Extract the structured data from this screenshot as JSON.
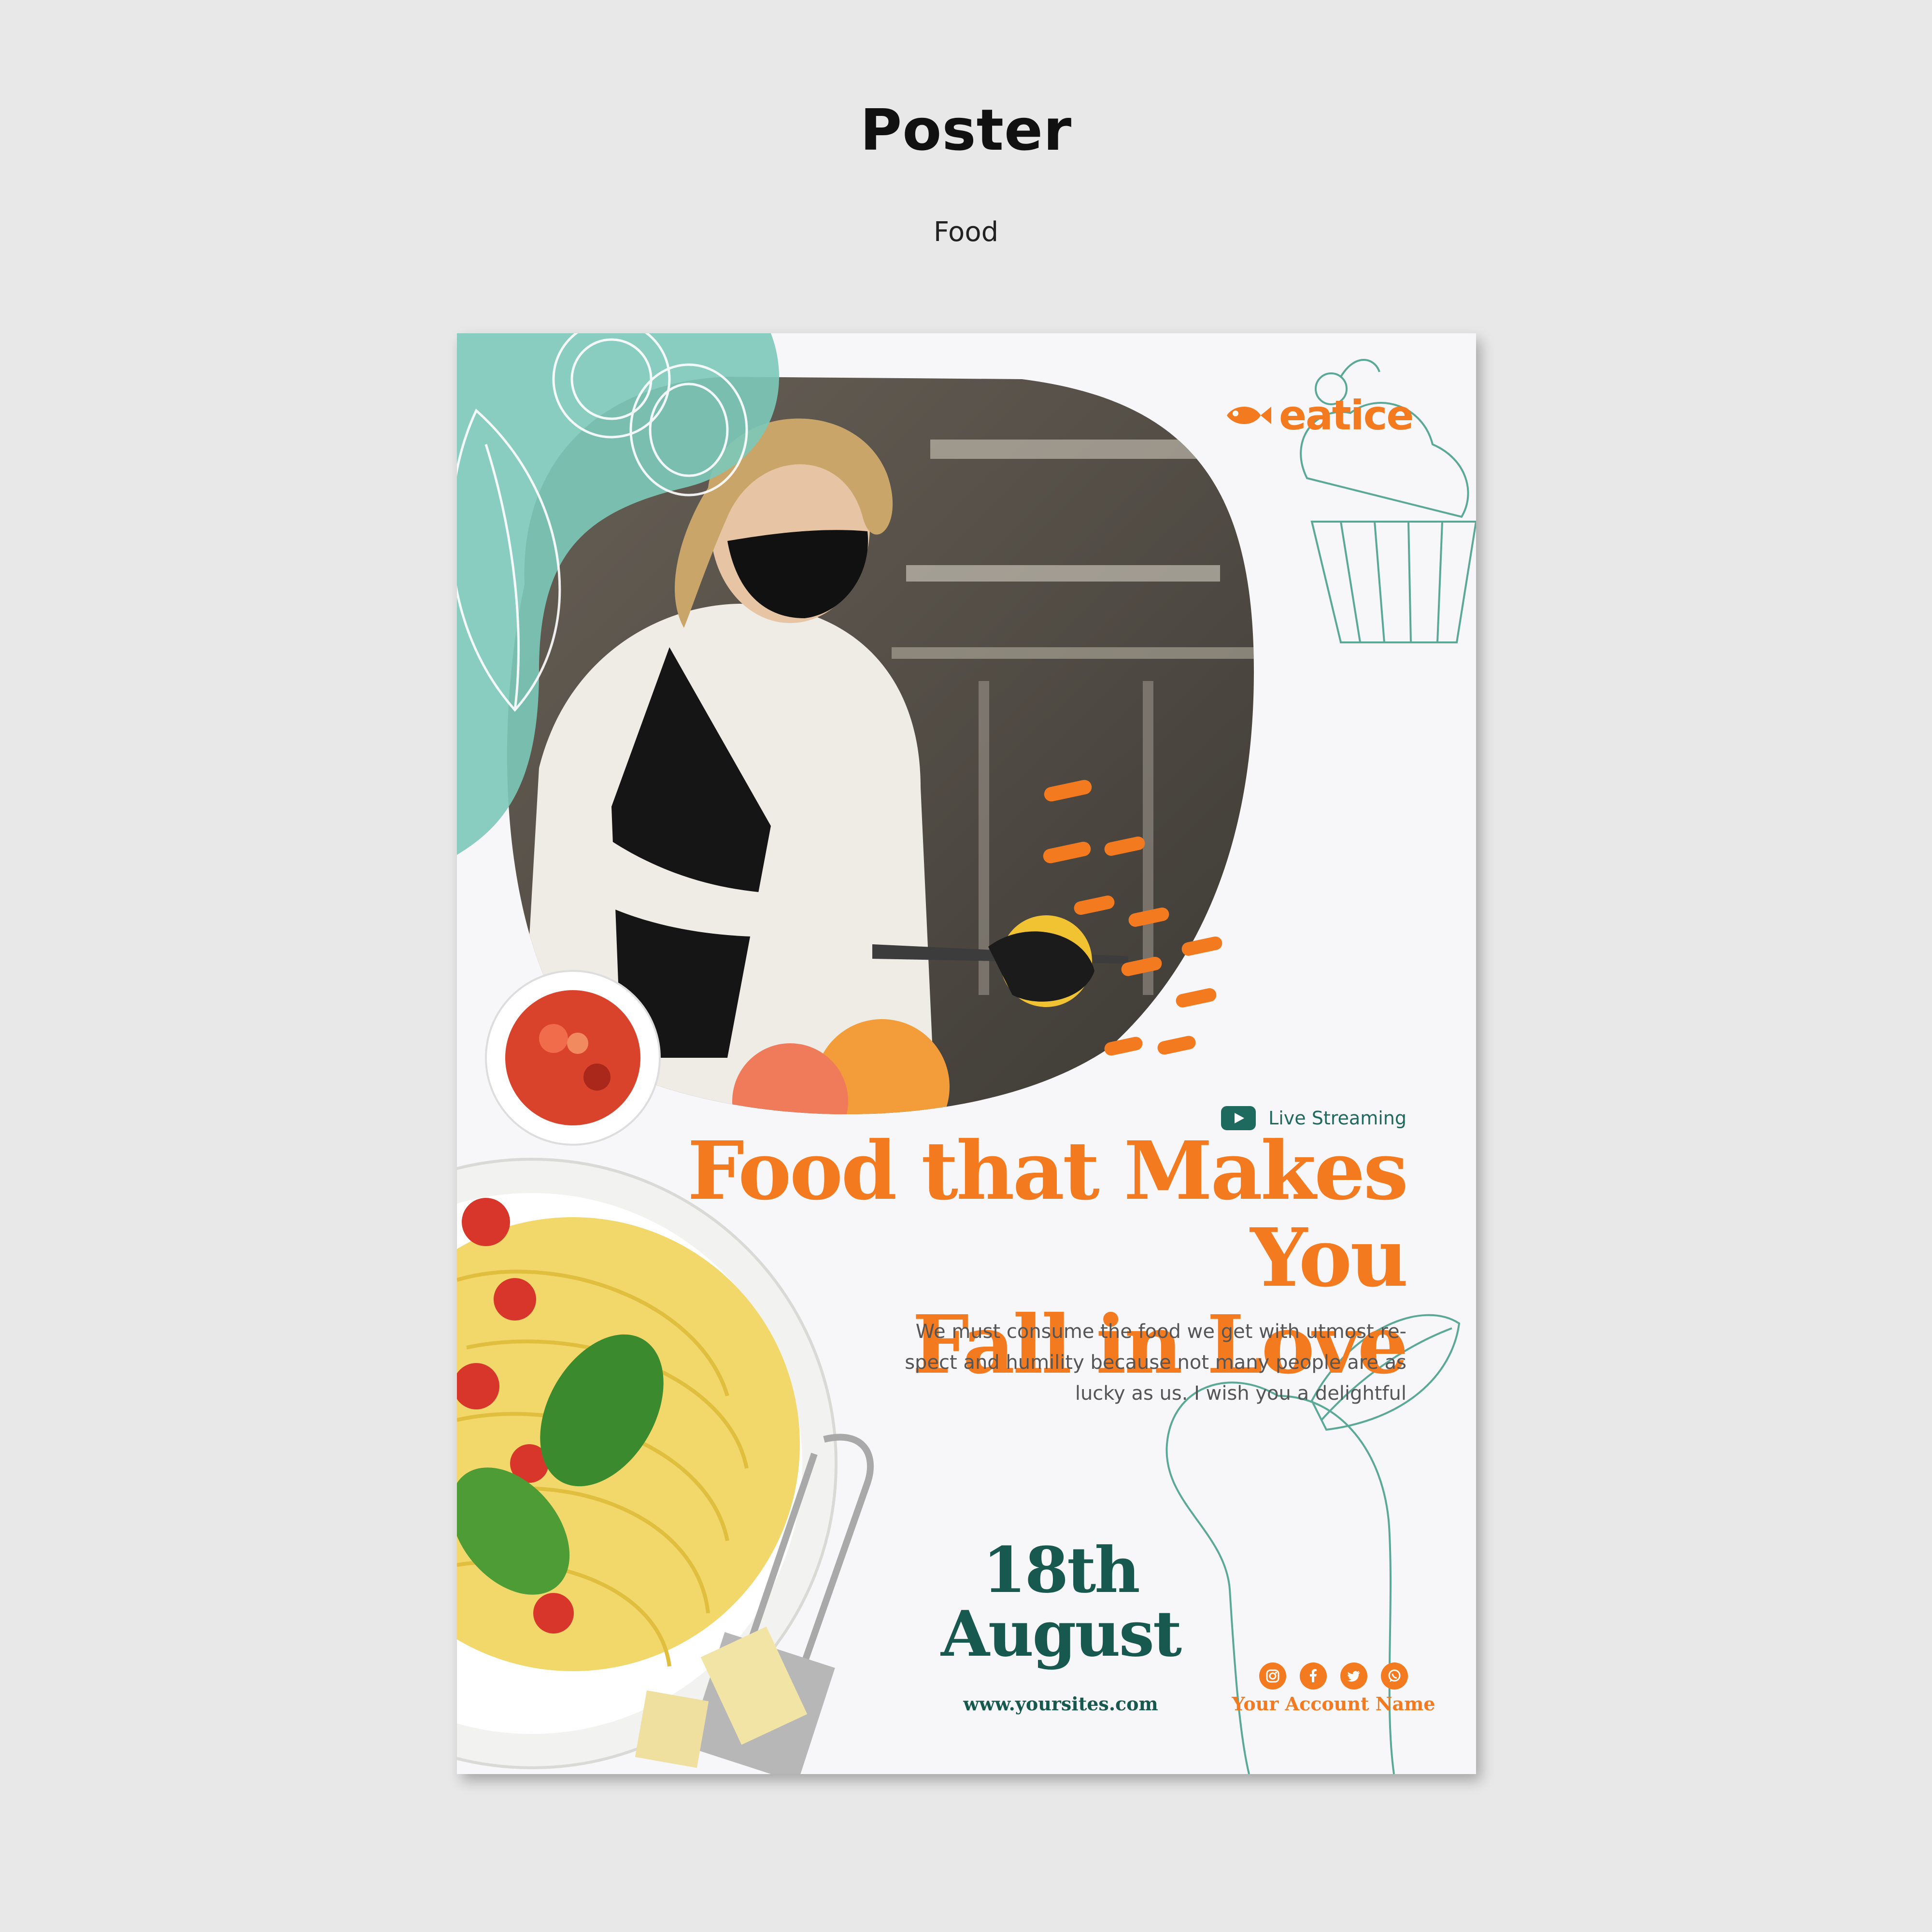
{
  "page": {
    "title": "Poster",
    "subtitle": "Food"
  },
  "poster": {
    "logo": {
      "text": "eatice",
      "icon": "fish-logo-icon"
    },
    "live": {
      "icon": "play-video-icon",
      "text": "Live Streaming"
    },
    "headline": {
      "line1": "Food that Makes You",
      "line2": "Fall in Love"
    },
    "body": {
      "line1": "We must consume the food we get with utmost re-",
      "line2": "spect and humility because not many people are as",
      "line3": "lucky as us. I wish you a delightful"
    },
    "date": {
      "line1": "18th",
      "line2": "August"
    },
    "website": "www.yoursites.com",
    "social": {
      "icons": [
        "instagram-icon",
        "facebook-icon",
        "twitter-icon",
        "whatsapp-icon"
      ],
      "account": "Your Account Name"
    },
    "colors": {
      "accent_orange": "#f47a20",
      "accent_teal": "#7cc9b9",
      "dark_green": "#17584f",
      "background": "#f7f6f9",
      "page_background": "#e8e8e8"
    }
  }
}
